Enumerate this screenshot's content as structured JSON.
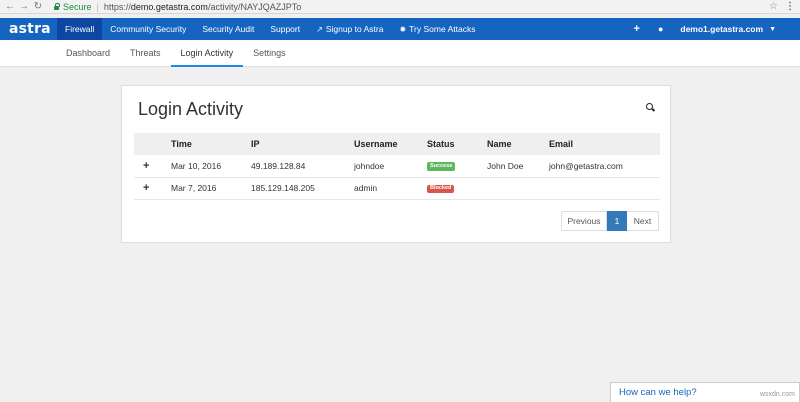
{
  "browser": {
    "secure_label": "Secure",
    "url_protocol": "https://",
    "url_host": "demo.getastra.com",
    "url_path": "/activity/NAYJQAZJPTo"
  },
  "topnav": {
    "logo": "astra",
    "items": [
      {
        "label": "Firewall"
      },
      {
        "label": "Community Security"
      },
      {
        "label": "Security Audit"
      },
      {
        "label": "Support"
      },
      {
        "label": "Signup to Astra"
      },
      {
        "label": "Try Some Attacks"
      }
    ],
    "account": "demo1.getastra.com"
  },
  "subnav": {
    "items": [
      {
        "label": "Dashboard"
      },
      {
        "label": "Threats"
      },
      {
        "label": "Login Activity"
      },
      {
        "label": "Settings"
      }
    ]
  },
  "card": {
    "title": "Login Activity"
  },
  "table": {
    "headers": [
      "Time",
      "IP",
      "Username",
      "Status",
      "Name",
      "Email"
    ],
    "rows": [
      {
        "time": "Mar 10, 2016",
        "ip": "49.189.128.84",
        "username": "johndoe",
        "status": "Success",
        "name": "John Doe",
        "email": "john@getastra.com"
      },
      {
        "time": "Mar 7, 2016",
        "ip": "185.129.148.205",
        "username": "admin",
        "status": "Blocked",
        "name": "",
        "email": ""
      }
    ]
  },
  "pagination": {
    "prev": "Previous",
    "current": "1",
    "next": "Next"
  },
  "help": {
    "label": "How can we help?"
  },
  "watermark": "wsxdn.com",
  "colors": {
    "brand": "#1565c0",
    "success": "#5cb85c",
    "blocked": "#d9534f"
  }
}
